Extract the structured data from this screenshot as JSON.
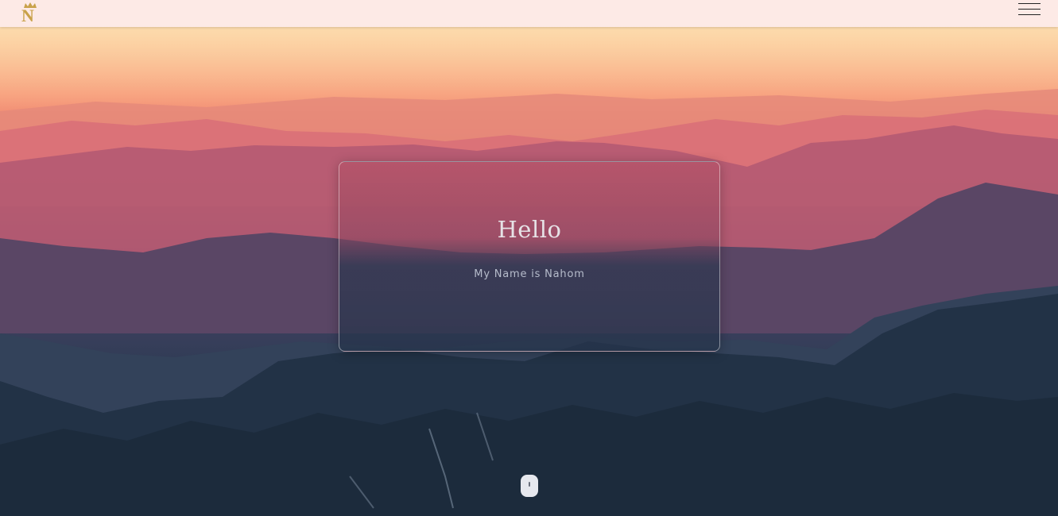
{
  "navbar": {
    "logo_letter": "N",
    "menu_icon": "hamburger-menu-icon"
  },
  "hero": {
    "title": "Hello",
    "subtitle": "My Name is Nahom",
    "scroll_icon": "scroll-mouse-icon"
  },
  "colors": {
    "navbar_bg": "#fdeae6",
    "logo_gold": "#c9a24a",
    "sky_top": "#f7c79a",
    "sky_mid": "#ea7a6e",
    "mountain_dark": "#1d2c3d"
  }
}
